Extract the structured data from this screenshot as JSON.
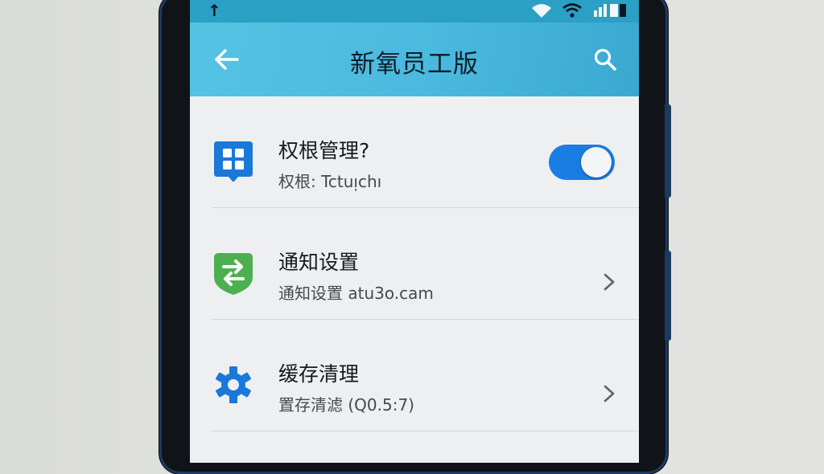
{
  "appbar": {
    "title": "新氧员工版",
    "back_icon": "arrow-left-icon",
    "search_icon": "search-icon"
  },
  "status_bar": {
    "icons": [
      "upload-arrow-icon",
      "wifi-icon",
      "wifi-icon",
      "signal-battery-icon"
    ]
  },
  "settings": [
    {
      "title": "权根管理?",
      "subtitle": "权根: Tctuᴉchı",
      "icon": "grid-chat-icon",
      "icon_color": "#1a78d8",
      "control": "toggle",
      "toggle_on": true
    },
    {
      "title": "通知设置",
      "subtitle": "通知设置 atu3o.cam",
      "icon": "swap-arrows-shield-icon",
      "icon_color": "#4caf50",
      "control": "chevron"
    },
    {
      "title": "缓存清理",
      "subtitle": "置存清滤 (Q0.5:7)",
      "icon": "gear-icon",
      "icon_color": "#1a78d8",
      "control": "chevron"
    }
  ],
  "colors": {
    "appbar": "#4ab9dd",
    "statusbar": "#2b9fc4",
    "accent": "#1a7de3",
    "screen_bg": "#eeeff1"
  }
}
